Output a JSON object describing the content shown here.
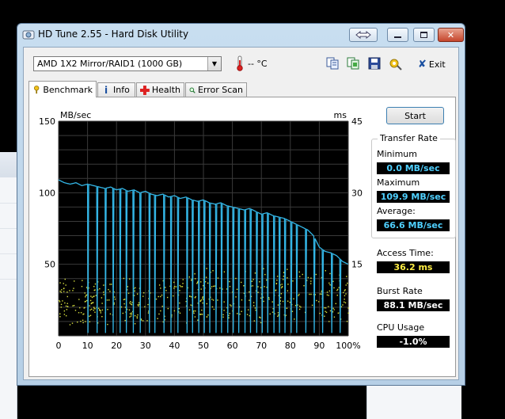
{
  "window": {
    "title": "HD Tune 2.55 - Hard Disk Utility"
  },
  "toolbar": {
    "drive": "AMD     1X2 Mirror/RAID1 (1000 GB)",
    "temperature": "-- °C",
    "exit_label": "Exit"
  },
  "tabs": [
    {
      "label": "Benchmark",
      "icon": "benchmark-icon"
    },
    {
      "label": "Info",
      "icon": "info-icon"
    },
    {
      "label": "Health",
      "icon": "health-icon"
    },
    {
      "label": "Error Scan",
      "icon": "error-scan-icon"
    }
  ],
  "benchmark": {
    "start_label": "Start",
    "transfer_rate_title": "Transfer Rate",
    "minimum_label": "Minimum",
    "minimum_value": "0.0 MB/sec",
    "maximum_label": "Maximum",
    "maximum_value": "109.9 MB/sec",
    "average_label": "Average:",
    "average_value": "66.6 MB/sec",
    "access_time_label": "Access Time:",
    "access_time_value": "36.2 ms",
    "burst_rate_label": "Burst Rate",
    "burst_rate_value": "88.1 MB/sec",
    "cpu_usage_label": "CPU Usage",
    "cpu_usage_value": "-1.0%"
  },
  "chart_data": {
    "type": "line",
    "y_left_label": "MB/sec",
    "y_right_label": "ms",
    "ylim_left": [
      0,
      150
    ],
    "ylim_right": [
      0,
      45
    ],
    "xlim": [
      0,
      100
    ],
    "y_left_ticks": [
      "150",
      "100",
      "50"
    ],
    "y_right_ticks": [
      "45",
      "30",
      "15"
    ],
    "x_ticks": [
      "0",
      "10",
      "20",
      "30",
      "40",
      "50",
      "60",
      "70",
      "80",
      "90",
      "100%"
    ],
    "grid": true,
    "colors": {
      "background": "#000000",
      "grid": "#3a3a3a",
      "transfer": "#33b5e5",
      "access": "#d8e040"
    },
    "series": [
      {
        "name": "Transfer Rate",
        "x": [
          0,
          2,
          4,
          6,
          8,
          10,
          12,
          14,
          16,
          18,
          20,
          22,
          24,
          26,
          28,
          30,
          32,
          34,
          36,
          38,
          40,
          42,
          44,
          46,
          48,
          50,
          52,
          54,
          56,
          58,
          60,
          62,
          64,
          66,
          68,
          70,
          72,
          74,
          76,
          78,
          80,
          82,
          84,
          86,
          88,
          90,
          92,
          94,
          96,
          98,
          100
        ],
        "y": [
          109,
          107,
          106,
          107,
          105,
          106,
          105,
          104,
          103,
          104,
          102,
          103,
          101,
          102,
          100,
          101,
          99,
          98,
          99,
          97,
          98,
          96,
          97,
          95,
          94,
          95,
          93,
          92,
          93,
          91,
          90,
          89,
          88,
          89,
          87,
          85,
          86,
          84,
          83,
          82,
          80,
          78,
          76,
          74,
          70,
          62,
          59,
          58,
          56,
          52,
          50
        ]
      }
    ],
    "dips": [
      10,
      13,
      16,
      18.5,
      21,
      23,
      25.5,
      28,
      31,
      33,
      36,
      38.5,
      41,
      44,
      46,
      48,
      50,
      52,
      54,
      56,
      58,
      60,
      62,
      64,
      66,
      68,
      70,
      72,
      74,
      76,
      78,
      80,
      82,
      85,
      88,
      91,
      94,
      97
    ]
  }
}
